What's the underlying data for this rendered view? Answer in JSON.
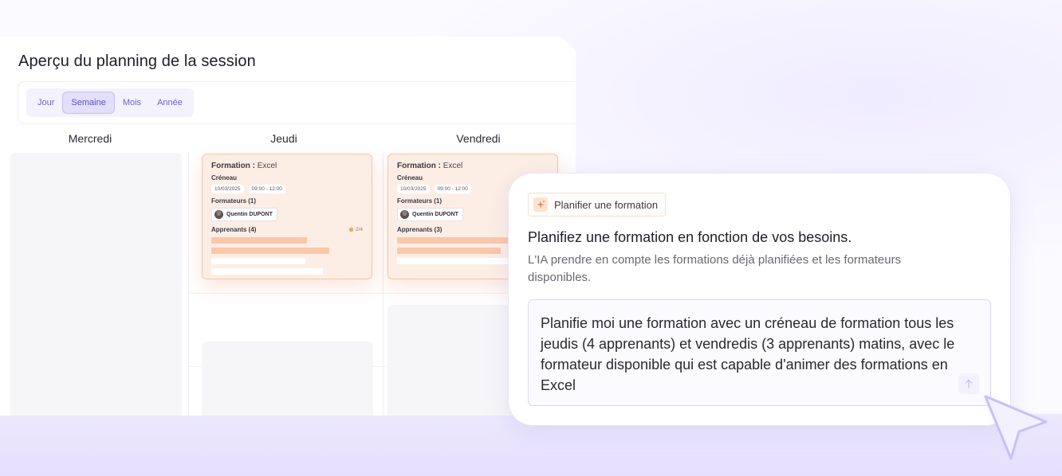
{
  "planning": {
    "title": "Aperçu du planning de la session",
    "view_tabs": [
      {
        "label": "Jour",
        "active": false
      },
      {
        "label": "Semaine",
        "active": true
      },
      {
        "label": "Mois",
        "active": false
      },
      {
        "label": "Année",
        "active": false
      }
    ],
    "days": [
      "Mercredi",
      "Jeudi",
      "Vendredi"
    ],
    "events": [
      {
        "formation_label": "Formation :",
        "formation_value": "Excel",
        "slot_label": "Créneau",
        "date": "10/03/2025",
        "time": "09:00 - 12:00",
        "trainers_label": "Formateurs (1)",
        "trainer_name": "Quentin DUPONT",
        "learners_label": "Apprenants (4)",
        "count": "2/4"
      },
      {
        "formation_label": "Formation :",
        "formation_value": "Excel",
        "slot_label": "Créneau",
        "date": "10/03/2025",
        "time": "09:00 - 12:00",
        "trainers_label": "Formateurs (1)",
        "trainer_name": "Quentin DUPONT",
        "learners_label": "Apprenants (3)"
      }
    ]
  },
  "ai": {
    "tag_label": "Planifier une formation",
    "heading": "Planifiez une formation en fonction de vos besoins.",
    "description": "L'IA prendre en compte les formations déjà planifiées et les formateurs disponibles.",
    "prompt": "Planifie moi une formation avec un créneau de formation tous les jeudis (4 apprenants) et vendredis (3 apprenants) matins, avec le formateur disponible qui est capable d'animer des formations en Excel",
    "tag_icon": "sparkle-icon",
    "send_icon": "arrow-up-icon"
  },
  "colors": {
    "accent": "#6e62d6",
    "event_bg": "#fdeee5",
    "event_border": "#f7c5a6",
    "cursor": "#c9c0f5"
  }
}
